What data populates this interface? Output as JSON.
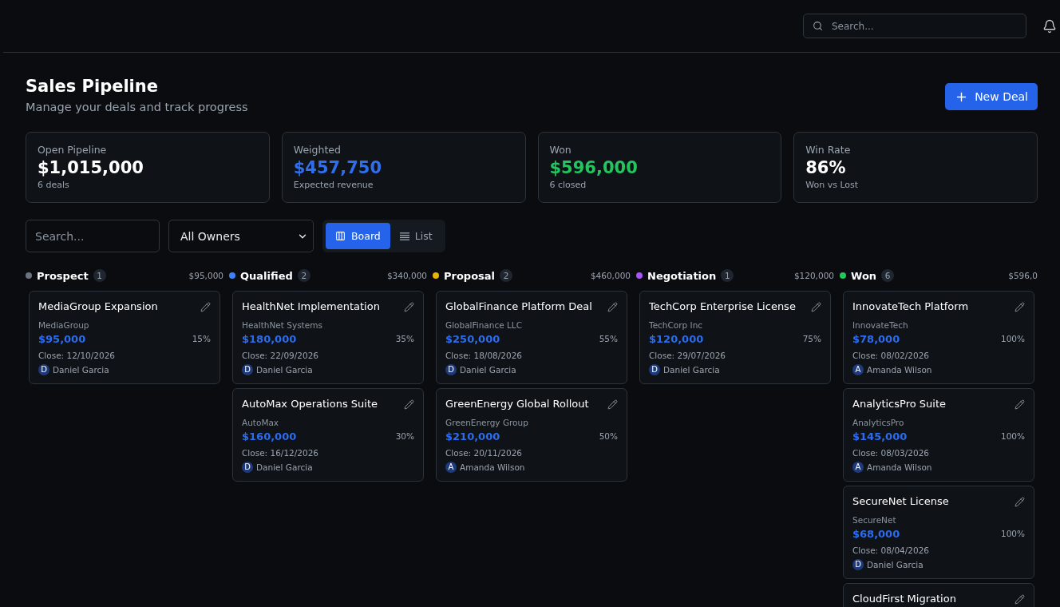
{
  "header": {
    "search": {
      "placeholder": "Search..."
    }
  },
  "page": {
    "title": "Sales Pipeline",
    "subtitle": "Manage your deals and track progress",
    "new_deal_button": "New Deal"
  },
  "stats": [
    {
      "label": "Open Pipeline",
      "value": "$1,015,000",
      "note": "6 deals",
      "color": "#ffffff"
    },
    {
      "label": "Weighted",
      "value": "$457,750",
      "note": "Expected revenue",
      "color": "#2f6fed"
    },
    {
      "label": "Won",
      "value": "$596,000",
      "note": "6 closed",
      "color": "#22c55e"
    },
    {
      "label": "Win Rate",
      "value": "86%",
      "note": "Won vs Lost",
      "color": "#ffffff"
    }
  ],
  "filters": {
    "search": {
      "placeholder": "Search..."
    },
    "owner_select": {
      "value": "All Owners"
    },
    "view_toggle": [
      {
        "label": "Board",
        "kind": "board",
        "selected": true
      },
      {
        "label": "List",
        "kind": "list",
        "selected": false
      }
    ]
  },
  "columns": [
    {
      "name": "Prospect",
      "color": "#6b7280",
      "count": "1",
      "total": "$95,000",
      "deals": [
        {
          "title": "MediaGroup Expansion",
          "company": "MediaGroup",
          "amount": "$95,000",
          "probability": "15%",
          "close": "Close: 12/10/2026",
          "owner_initial": "D",
          "owner": "Daniel Garcia"
        }
      ]
    },
    {
      "name": "Qualified",
      "color": "#3b82f6",
      "count": "2",
      "total": "$340,000",
      "deals": [
        {
          "title": "HealthNet Implementation",
          "company": "HealthNet Systems",
          "amount": "$180,000",
          "probability": "35%",
          "close": "Close: 22/09/2026",
          "owner_initial": "D",
          "owner": "Daniel Garcia"
        },
        {
          "title": "AutoMax Operations Suite",
          "company": "AutoMax",
          "amount": "$160,000",
          "probability": "30%",
          "close": "Close: 16/12/2026",
          "owner_initial": "D",
          "owner": "Daniel Garcia"
        }
      ]
    },
    {
      "name": "Proposal",
      "color": "#eab308",
      "count": "2",
      "total": "$460,000",
      "deals": [
        {
          "title": "GlobalFinance Platform Deal",
          "company": "GlobalFinance LLC",
          "amount": "$250,000",
          "probability": "55%",
          "close": "Close: 18/08/2026",
          "owner_initial": "D",
          "owner": "Daniel Garcia"
        },
        {
          "title": "GreenEnergy Global Rollout",
          "company": "GreenEnergy Group",
          "amount": "$210,000",
          "probability": "50%",
          "close": "Close: 20/11/2026",
          "owner_initial": "A",
          "owner": "Amanda Wilson"
        }
      ]
    },
    {
      "name": "Negotiation",
      "color": "#a855f7",
      "count": "1",
      "total": "$120,000",
      "deals": [
        {
          "title": "TechCorp Enterprise License",
          "company": "TechCorp Inc",
          "amount": "$120,000",
          "probability": "75%",
          "close": "Close: 29/07/2026",
          "owner_initial": "D",
          "owner": "Daniel Garcia"
        }
      ]
    },
    {
      "name": "Won",
      "color": "#22c55e",
      "count": "6",
      "total": "$596,0",
      "deals": [
        {
          "title": "InnovateTech Platform",
          "company": "InnovateTech",
          "amount": "$78,000",
          "probability": "100%",
          "close": "Close: 08/02/2026",
          "owner_initial": "A",
          "owner": "Amanda Wilson"
        },
        {
          "title": "AnalyticsPro Suite",
          "company": "AnalyticsPro",
          "amount": "$145,000",
          "probability": "100%",
          "close": "Close: 08/03/2026",
          "owner_initial": "A",
          "owner": "Amanda Wilson"
        },
        {
          "title": "SecureNet License",
          "company": "SecureNet",
          "amount": "$68,000",
          "probability": "100%",
          "close": "Close: 08/04/2026",
          "owner_initial": "D",
          "owner": "Daniel Garcia"
        },
        {
          "title": "CloudFirst Migration"
        }
      ]
    }
  ]
}
